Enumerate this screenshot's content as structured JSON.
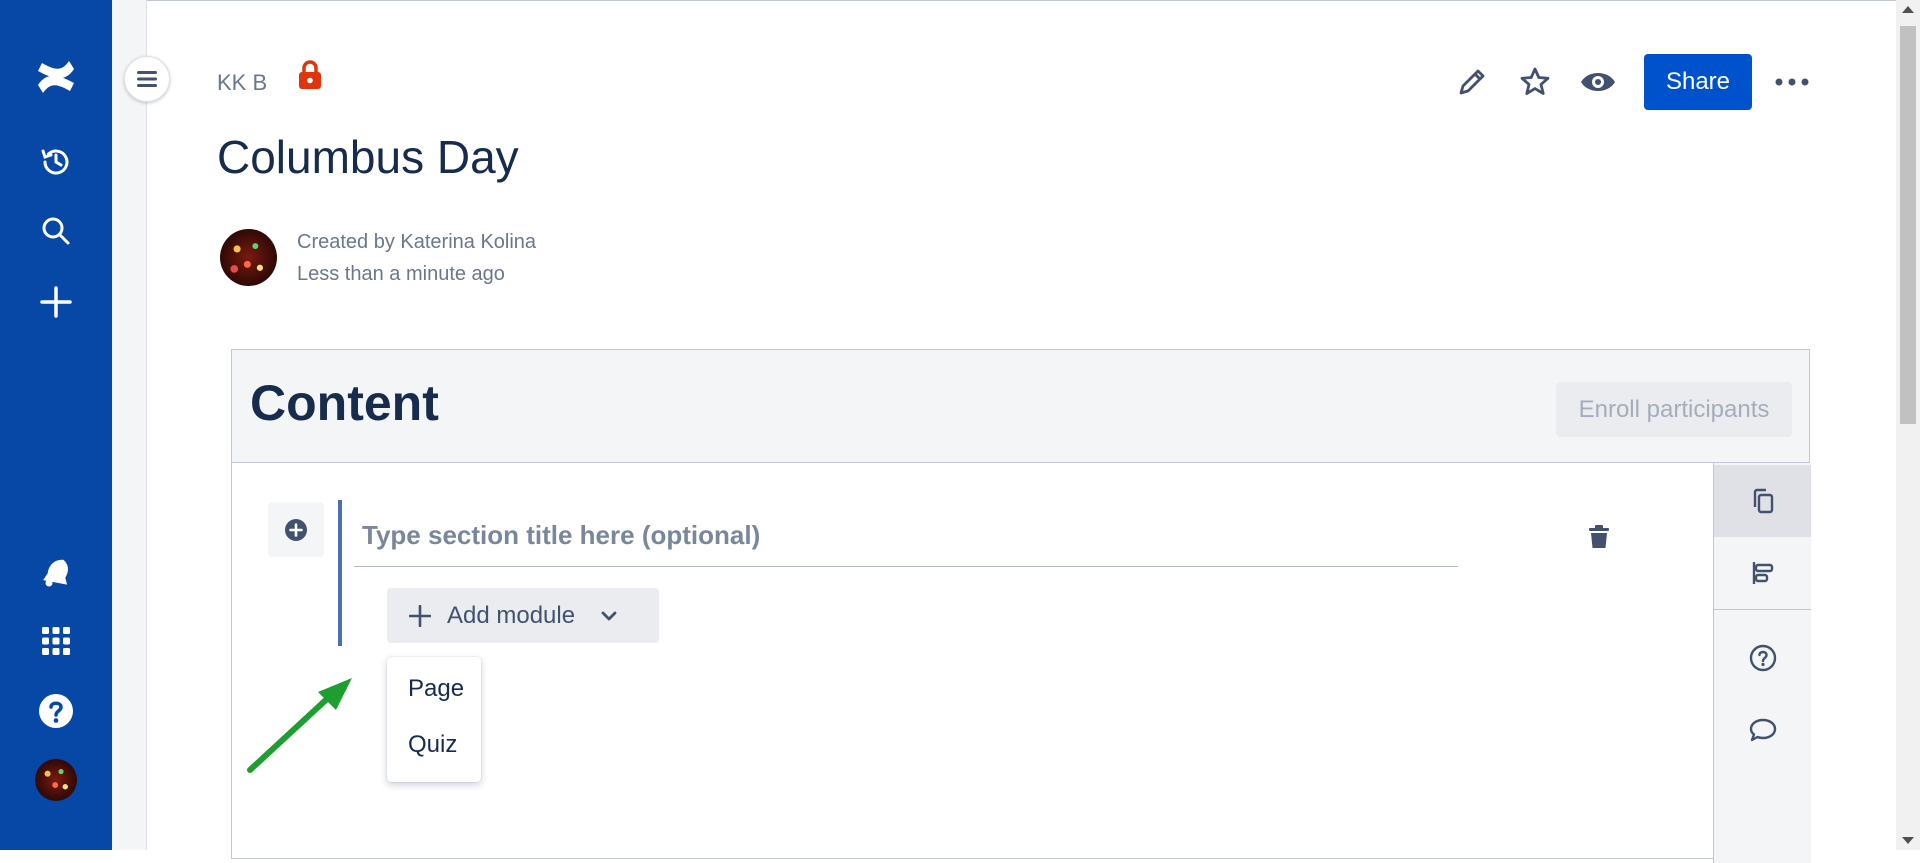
{
  "breadcrumb": {
    "space": "KK B"
  },
  "page": {
    "title": "Columbus Day",
    "created_by": "Created by Katerina Kolina",
    "updated": "Less than a minute ago"
  },
  "header_actions": {
    "share_label": "Share"
  },
  "content": {
    "title": "Content",
    "enroll_label": "Enroll participants",
    "section_placeholder": "Type section title here (optional)",
    "add_module_label": "Add module",
    "dropdown_items": [
      "Page",
      "Quiz"
    ]
  },
  "colors": {
    "nav_bg": "#0747a6",
    "primary": "#0052cc",
    "lock": "#de350b",
    "annotation_arrow": "#1e9e2e"
  },
  "icons": {
    "global_nav": [
      "confluence-logo-icon",
      "recent-history-icon",
      "search-icon",
      "create-plus-icon",
      "notifications-icon",
      "app-switcher-icon",
      "help-icon",
      "user-avatar"
    ],
    "header": [
      "edit-pencil-icon",
      "star-icon",
      "watch-eye-icon",
      "more-actions-icon"
    ],
    "side_tools": [
      "copy-icon",
      "align-icon",
      "help-circle-icon",
      "comment-icon"
    ]
  }
}
